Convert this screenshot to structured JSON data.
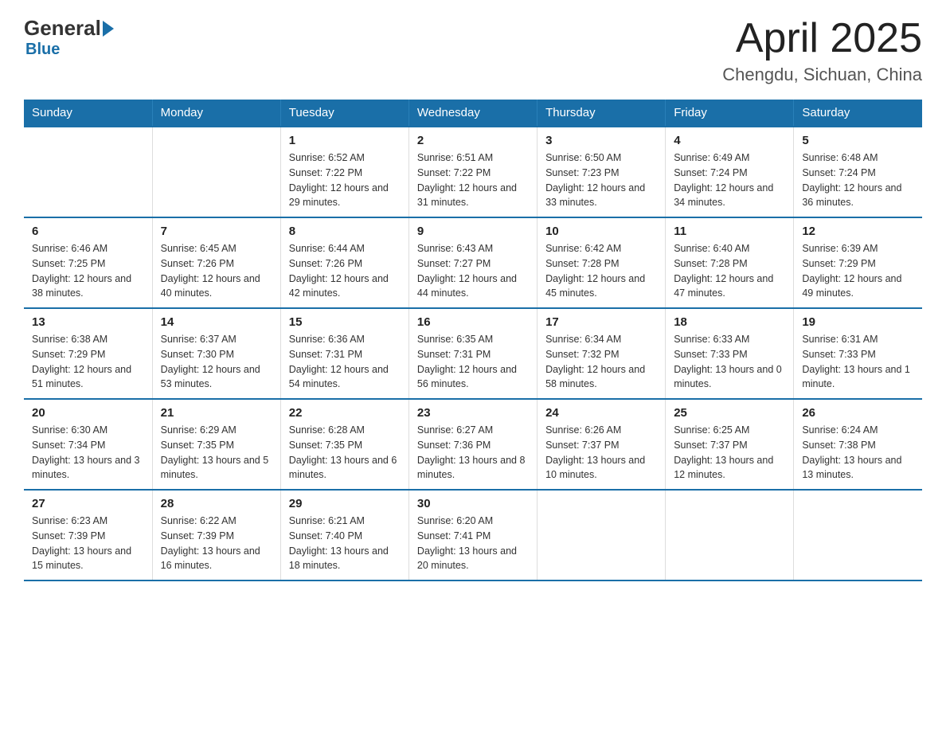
{
  "header": {
    "logo_general": "General",
    "logo_blue": "Blue",
    "title": "April 2025",
    "location": "Chengdu, Sichuan, China"
  },
  "days_of_week": [
    "Sunday",
    "Monday",
    "Tuesday",
    "Wednesday",
    "Thursday",
    "Friday",
    "Saturday"
  ],
  "weeks": [
    [
      {
        "day": "",
        "sunrise": "",
        "sunset": "",
        "daylight": ""
      },
      {
        "day": "",
        "sunrise": "",
        "sunset": "",
        "daylight": ""
      },
      {
        "day": "1",
        "sunrise": "Sunrise: 6:52 AM",
        "sunset": "Sunset: 7:22 PM",
        "daylight": "Daylight: 12 hours and 29 minutes."
      },
      {
        "day": "2",
        "sunrise": "Sunrise: 6:51 AM",
        "sunset": "Sunset: 7:22 PM",
        "daylight": "Daylight: 12 hours and 31 minutes."
      },
      {
        "day": "3",
        "sunrise": "Sunrise: 6:50 AM",
        "sunset": "Sunset: 7:23 PM",
        "daylight": "Daylight: 12 hours and 33 minutes."
      },
      {
        "day": "4",
        "sunrise": "Sunrise: 6:49 AM",
        "sunset": "Sunset: 7:24 PM",
        "daylight": "Daylight: 12 hours and 34 minutes."
      },
      {
        "day": "5",
        "sunrise": "Sunrise: 6:48 AM",
        "sunset": "Sunset: 7:24 PM",
        "daylight": "Daylight: 12 hours and 36 minutes."
      }
    ],
    [
      {
        "day": "6",
        "sunrise": "Sunrise: 6:46 AM",
        "sunset": "Sunset: 7:25 PM",
        "daylight": "Daylight: 12 hours and 38 minutes."
      },
      {
        "day": "7",
        "sunrise": "Sunrise: 6:45 AM",
        "sunset": "Sunset: 7:26 PM",
        "daylight": "Daylight: 12 hours and 40 minutes."
      },
      {
        "day": "8",
        "sunrise": "Sunrise: 6:44 AM",
        "sunset": "Sunset: 7:26 PM",
        "daylight": "Daylight: 12 hours and 42 minutes."
      },
      {
        "day": "9",
        "sunrise": "Sunrise: 6:43 AM",
        "sunset": "Sunset: 7:27 PM",
        "daylight": "Daylight: 12 hours and 44 minutes."
      },
      {
        "day": "10",
        "sunrise": "Sunrise: 6:42 AM",
        "sunset": "Sunset: 7:28 PM",
        "daylight": "Daylight: 12 hours and 45 minutes."
      },
      {
        "day": "11",
        "sunrise": "Sunrise: 6:40 AM",
        "sunset": "Sunset: 7:28 PM",
        "daylight": "Daylight: 12 hours and 47 minutes."
      },
      {
        "day": "12",
        "sunrise": "Sunrise: 6:39 AM",
        "sunset": "Sunset: 7:29 PM",
        "daylight": "Daylight: 12 hours and 49 minutes."
      }
    ],
    [
      {
        "day": "13",
        "sunrise": "Sunrise: 6:38 AM",
        "sunset": "Sunset: 7:29 PM",
        "daylight": "Daylight: 12 hours and 51 minutes."
      },
      {
        "day": "14",
        "sunrise": "Sunrise: 6:37 AM",
        "sunset": "Sunset: 7:30 PM",
        "daylight": "Daylight: 12 hours and 53 minutes."
      },
      {
        "day": "15",
        "sunrise": "Sunrise: 6:36 AM",
        "sunset": "Sunset: 7:31 PM",
        "daylight": "Daylight: 12 hours and 54 minutes."
      },
      {
        "day": "16",
        "sunrise": "Sunrise: 6:35 AM",
        "sunset": "Sunset: 7:31 PM",
        "daylight": "Daylight: 12 hours and 56 minutes."
      },
      {
        "day": "17",
        "sunrise": "Sunrise: 6:34 AM",
        "sunset": "Sunset: 7:32 PM",
        "daylight": "Daylight: 12 hours and 58 minutes."
      },
      {
        "day": "18",
        "sunrise": "Sunrise: 6:33 AM",
        "sunset": "Sunset: 7:33 PM",
        "daylight": "Daylight: 13 hours and 0 minutes."
      },
      {
        "day": "19",
        "sunrise": "Sunrise: 6:31 AM",
        "sunset": "Sunset: 7:33 PM",
        "daylight": "Daylight: 13 hours and 1 minute."
      }
    ],
    [
      {
        "day": "20",
        "sunrise": "Sunrise: 6:30 AM",
        "sunset": "Sunset: 7:34 PM",
        "daylight": "Daylight: 13 hours and 3 minutes."
      },
      {
        "day": "21",
        "sunrise": "Sunrise: 6:29 AM",
        "sunset": "Sunset: 7:35 PM",
        "daylight": "Daylight: 13 hours and 5 minutes."
      },
      {
        "day": "22",
        "sunrise": "Sunrise: 6:28 AM",
        "sunset": "Sunset: 7:35 PM",
        "daylight": "Daylight: 13 hours and 6 minutes."
      },
      {
        "day": "23",
        "sunrise": "Sunrise: 6:27 AM",
        "sunset": "Sunset: 7:36 PM",
        "daylight": "Daylight: 13 hours and 8 minutes."
      },
      {
        "day": "24",
        "sunrise": "Sunrise: 6:26 AM",
        "sunset": "Sunset: 7:37 PM",
        "daylight": "Daylight: 13 hours and 10 minutes."
      },
      {
        "day": "25",
        "sunrise": "Sunrise: 6:25 AM",
        "sunset": "Sunset: 7:37 PM",
        "daylight": "Daylight: 13 hours and 12 minutes."
      },
      {
        "day": "26",
        "sunrise": "Sunrise: 6:24 AM",
        "sunset": "Sunset: 7:38 PM",
        "daylight": "Daylight: 13 hours and 13 minutes."
      }
    ],
    [
      {
        "day": "27",
        "sunrise": "Sunrise: 6:23 AM",
        "sunset": "Sunset: 7:39 PM",
        "daylight": "Daylight: 13 hours and 15 minutes."
      },
      {
        "day": "28",
        "sunrise": "Sunrise: 6:22 AM",
        "sunset": "Sunset: 7:39 PM",
        "daylight": "Daylight: 13 hours and 16 minutes."
      },
      {
        "day": "29",
        "sunrise": "Sunrise: 6:21 AM",
        "sunset": "Sunset: 7:40 PM",
        "daylight": "Daylight: 13 hours and 18 minutes."
      },
      {
        "day": "30",
        "sunrise": "Sunrise: 6:20 AM",
        "sunset": "Sunset: 7:41 PM",
        "daylight": "Daylight: 13 hours and 20 minutes."
      },
      {
        "day": "",
        "sunrise": "",
        "sunset": "",
        "daylight": ""
      },
      {
        "day": "",
        "sunrise": "",
        "sunset": "",
        "daylight": ""
      },
      {
        "day": "",
        "sunrise": "",
        "sunset": "",
        "daylight": ""
      }
    ]
  ]
}
